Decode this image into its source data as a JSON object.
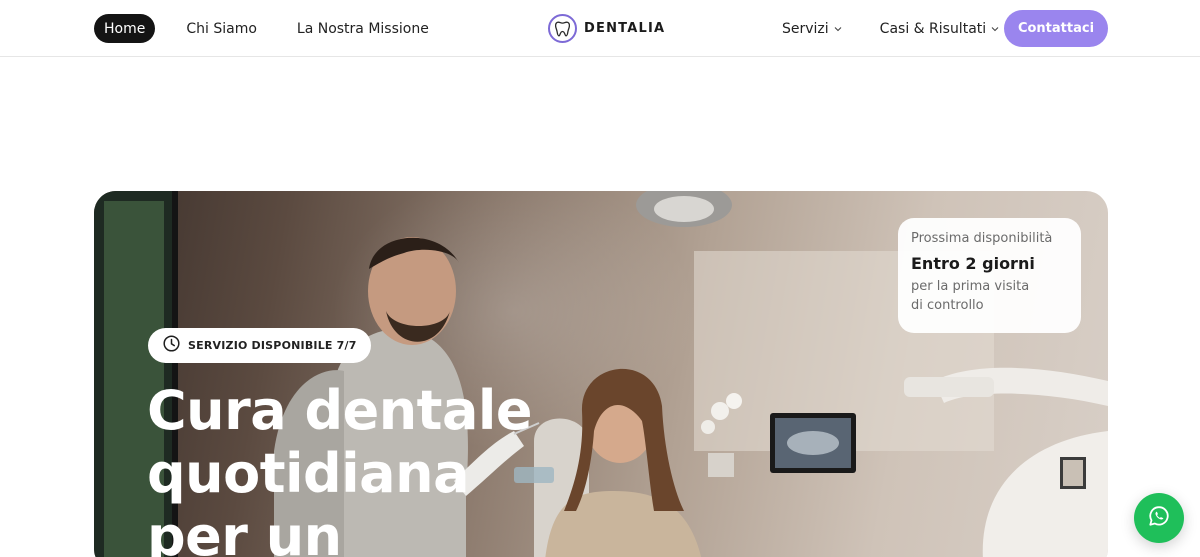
{
  "header": {
    "nav_left": [
      {
        "label": "Home",
        "active": true
      },
      {
        "label": "Chi Siamo",
        "active": false
      },
      {
        "label": "La Nostra Missione",
        "active": false
      }
    ],
    "logo": {
      "text": "DENTALIA",
      "icon": "tooth-icon",
      "accent": "#7d6ad6"
    },
    "nav_right": [
      {
        "label": "Servizi",
        "icon": "chevron-down-icon"
      },
      {
        "label": "Casi & Risultati",
        "icon": "chevron-down-icon"
      }
    ],
    "cta": {
      "label": "Contattaci",
      "color": "#9a85ee"
    }
  },
  "hero": {
    "badge": {
      "icon": "clock-icon",
      "text": "SERVIZIO DISPONIBILE 7/7"
    },
    "headline_lines": [
      "Cura dentale",
      "quotidiana",
      "per un"
    ],
    "availability": {
      "label": "Prossima disponibilità",
      "title": "Entro 2 giorni",
      "sub_lines": [
        "per la prima visita",
        "di controllo"
      ]
    }
  },
  "fab": {
    "icon": "whatsapp-icon",
    "color": "#1fbf5a"
  }
}
